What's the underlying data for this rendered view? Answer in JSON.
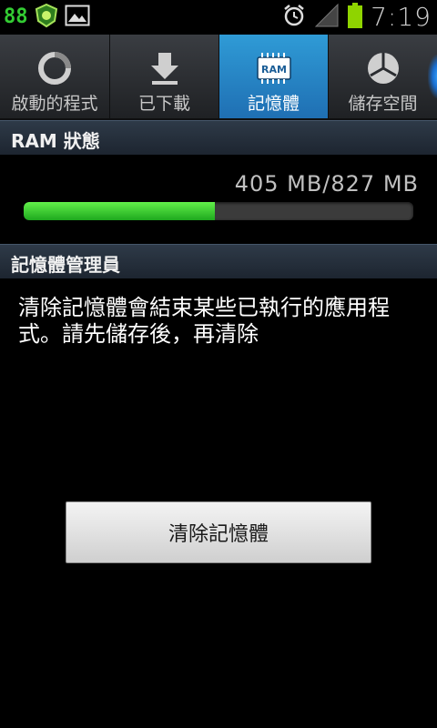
{
  "status_bar": {
    "left_text": "88",
    "time": "7:19",
    "battery_color": "#8fd400"
  },
  "tabs": [
    {
      "label": "啟動的程式",
      "icon": "running-apps-icon",
      "active": false
    },
    {
      "label": "已下載",
      "icon": "download-icon",
      "active": false
    },
    {
      "label": "記憶體",
      "icon": "ram-icon",
      "icon_text": "RAM",
      "active": true
    },
    {
      "label": "儲存空間",
      "icon": "storage-pie-icon",
      "active": false
    }
  ],
  "ram_status": {
    "header": "RAM 狀態",
    "used": "405 MB",
    "separator": "/",
    "total": "827 MB",
    "fill_fraction": 0.49
  },
  "memory_manager": {
    "header": "記憶體管理員",
    "description": "清除記憶體會結束某些已執行的應用程式。請先儲存後，再清除",
    "button_label": "清除記憶體"
  },
  "colors": {
    "accent_tab": "#2585c8",
    "progress_green": "#3bd32c"
  }
}
